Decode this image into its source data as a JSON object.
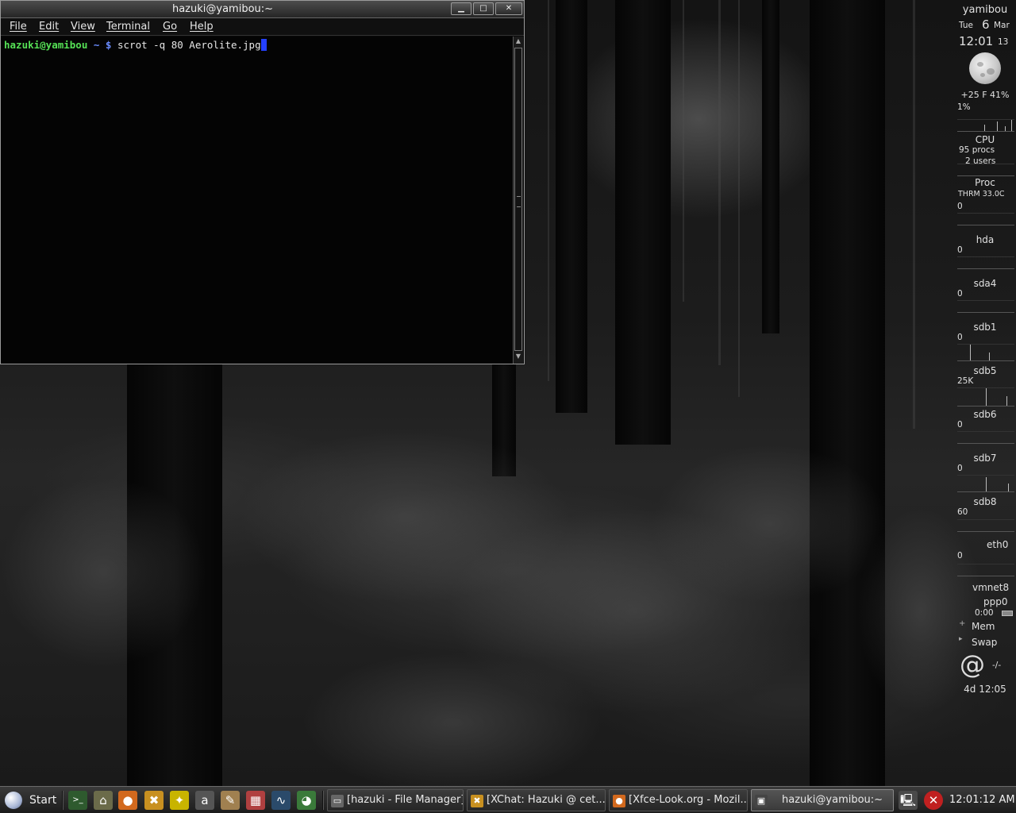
{
  "terminal": {
    "title": "hazuki@yamibou:~",
    "buttons": {
      "minimize": "▁",
      "maximize": "□",
      "close": "✕"
    },
    "menu": [
      "File",
      "Edit",
      "View",
      "Terminal",
      "Go",
      "Help"
    ],
    "prompt_user": "hazuki@yamibou",
    "prompt_dir": " ~ $",
    "command": " scrot -q 80 Aerolite.jpg",
    "scroll_up": "▲",
    "scroll_down": "▼"
  },
  "monitor": {
    "hostname": "yamibou",
    "day": "Tue",
    "date_num": "6",
    "month": "Mar",
    "time": "12:01",
    "seconds": "13",
    "weather": "+25 F 41%",
    "cpu_percent": "1%",
    "cpu_label": "CPU",
    "procs": "95 procs",
    "users": "2 users",
    "proc_label": "Proc",
    "thermal": "THRM 33.0C",
    "disks": [
      {
        "name": "hda",
        "value": "0"
      },
      {
        "name": "sda4",
        "value": "0"
      },
      {
        "name": "sdb1",
        "value": "0"
      },
      {
        "name": "sdb5",
        "value": "25K"
      },
      {
        "name": "sdb6",
        "value": "0"
      },
      {
        "name": "sdb7",
        "value": "0"
      },
      {
        "name": "sdb8",
        "value": "60"
      }
    ],
    "thrm_value": "0",
    "eth0_label": "eth0",
    "eth0_value": "0",
    "vmnet8_label": "vmnet8",
    "ppp0_label": "ppp0",
    "ppp0_time": "0:00",
    "mem_label": "Mem",
    "swap_label": "Swap",
    "mail_icon": "@",
    "mail_count": "-/-",
    "uptime": "4d 12:05"
  },
  "taskbar": {
    "start_label": "Start",
    "launchers": [
      {
        "icon": "terminal-icon",
        "glyph": ">_",
        "color": "#2e5a2e"
      },
      {
        "icon": "home-folder-icon",
        "glyph": "⌂",
        "color": "#6b6b4a"
      },
      {
        "icon": "firefox-icon",
        "glyph": "●",
        "color": "#d2691e"
      },
      {
        "icon": "xchat-icon",
        "glyph": "✖",
        "color": "#c89020"
      },
      {
        "icon": "aim-icon",
        "glyph": "✦",
        "color": "#c8b400"
      },
      {
        "icon": "a-icon",
        "glyph": "a",
        "color": "#555555"
      },
      {
        "icon": "text-editor-icon",
        "glyph": "✎",
        "color": "#a08050"
      },
      {
        "icon": "spreadsheet-icon",
        "glyph": "▦",
        "color": "#b04040"
      },
      {
        "icon": "system-monitor-icon",
        "glyph": "∿",
        "color": "#2a4a6a"
      },
      {
        "icon": "graphics-icon",
        "glyph": "◕",
        "color": "#3a7a3a"
      }
    ],
    "tasks": [
      {
        "label": "[hazuki - File Manager]",
        "icon": "folder-icon",
        "glyph": "▭",
        "color": "#666666"
      },
      {
        "label": "[XChat: Hazuki @ cet...",
        "icon": "xchat-icon",
        "glyph": "✖",
        "color": "#c89020"
      },
      {
        "label": "[Xfce-Look.org - Mozil...",
        "icon": "firefox-icon",
        "glyph": "●",
        "color": "#d2691e"
      },
      {
        "label": "hazuki@yamibou:~",
        "icon": "terminal-icon",
        "glyph": "▣",
        "color": "#444444"
      }
    ],
    "tray": [
      {
        "icon": "network-icon",
        "glyph": "🖳",
        "color": "#4a4a4a"
      },
      {
        "icon": "stop-icon",
        "glyph": "✕",
        "color": "#c02020"
      }
    ],
    "clock": "12:01:12 AM"
  }
}
